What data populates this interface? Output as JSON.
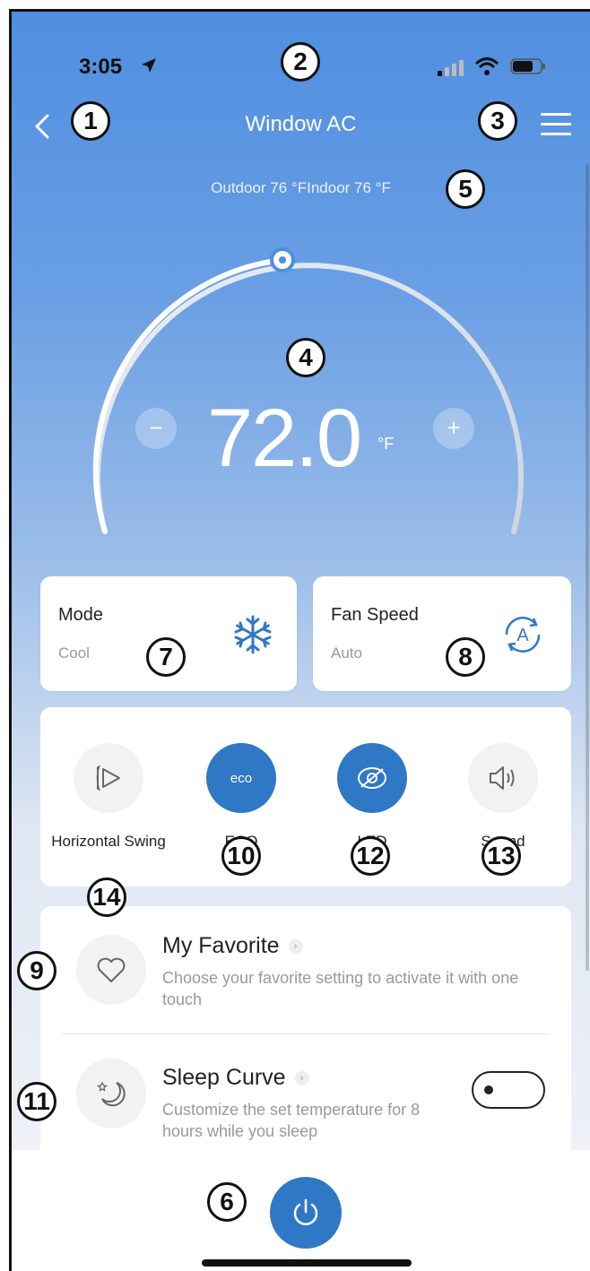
{
  "status_bar": {
    "time": "3:05"
  },
  "nav": {
    "title": "Window AC"
  },
  "temps": {
    "outdoor_label": "Outdoor 76 °F",
    "indoor_label": "Indoor 76 °F"
  },
  "dial": {
    "value": "72.0",
    "unit": "°F",
    "minus": "−",
    "plus": "+"
  },
  "mode_card": {
    "title": "Mode",
    "value": "Cool",
    "icon": "snowflake-icon"
  },
  "fan_card": {
    "title": "Fan Speed",
    "value": "Auto",
    "icon": "auto-fan-icon"
  },
  "functions": [
    {
      "label": "Horizontal Swing",
      "state": "off",
      "icon": "horizontal-swing-icon"
    },
    {
      "label": "ECO",
      "state": "on",
      "icon": "eco-icon"
    },
    {
      "label": "LED",
      "state": "on",
      "icon": "led-icon"
    },
    {
      "label": "Sound",
      "state": "off",
      "icon": "sound-icon"
    }
  ],
  "list": [
    {
      "title": "My Favorite",
      "desc": "Choose your favorite setting to activate it with one touch",
      "icon": "heart-icon"
    },
    {
      "title": "Sleep Curve",
      "desc": "Customize the set temperature for 8 hours while you sleep",
      "icon": "moon-star-icon",
      "toggle": "off"
    }
  ],
  "callouts": [
    "1",
    "2",
    "3",
    "4",
    "5",
    "6",
    "7",
    "8",
    "9",
    "10",
    "11",
    "12",
    "13",
    "14"
  ],
  "colors": {
    "accent": "#2f78c6",
    "sky_top": "#4f8ee0",
    "card_bg": "#ffffff"
  }
}
